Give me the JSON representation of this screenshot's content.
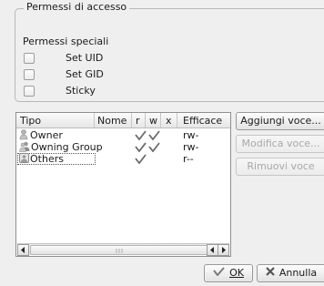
{
  "access_group": {
    "title": "Permessi di accesso",
    "special_label": "Permessi speciali",
    "checkboxes": [
      {
        "label": "Set UID",
        "checked": false
      },
      {
        "label": "Set GID",
        "checked": false
      },
      {
        "label": "Sticky",
        "checked": false
      }
    ]
  },
  "table": {
    "columns": [
      "Tipo",
      "Nome",
      "r",
      "w",
      "x",
      "Efficace"
    ],
    "rows": [
      {
        "tipo": "Owner",
        "icon": "user-icon",
        "nome": "",
        "r": true,
        "w": true,
        "x": false,
        "efficace": "rw-"
      },
      {
        "tipo": "Owning Group",
        "icon": "group-icon",
        "nome": "",
        "r": true,
        "w": true,
        "x": false,
        "efficace": "rw-"
      },
      {
        "tipo": "Others",
        "icon": "others-icon",
        "nome": "",
        "r": true,
        "w": false,
        "x": false,
        "efficace": "r--"
      }
    ]
  },
  "side_buttons": {
    "add": "Aggiungi voce...",
    "modify": "Modifica voce...",
    "remove": "Rimuovi voce"
  },
  "dialog_buttons": {
    "ok": "OK",
    "cancel": "Annulla"
  },
  "colors": {
    "check": "#6a6a6a",
    "ok_icon": "#7a7a7a",
    "cancel_icon": "#555555"
  }
}
